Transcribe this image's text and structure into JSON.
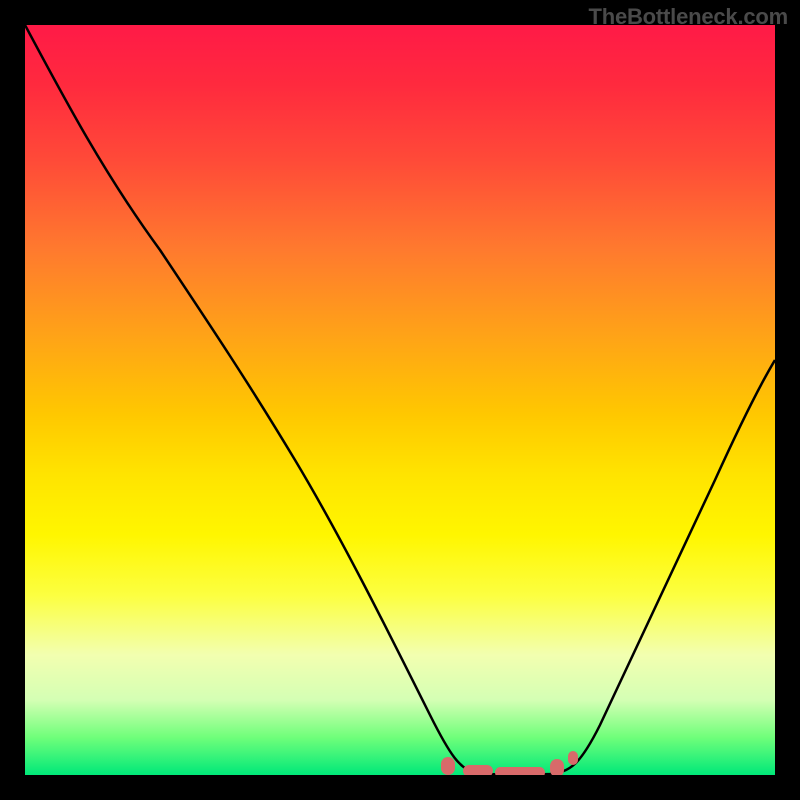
{
  "attribution": "TheBottleneck.com",
  "colors": {
    "frame": "#000000",
    "curve": "#000000",
    "marker": "#d86a6a",
    "gradient_top": "#ff1a47",
    "gradient_bottom": "#00e879"
  },
  "chart_data": {
    "type": "line",
    "title": "",
    "xlabel": "",
    "ylabel": "",
    "xlim": [
      0,
      100
    ],
    "ylim": [
      0,
      100
    ],
    "note": "Axes are unlabeled; values are visual estimates on a 0–100 scale. Curve is a V shape with a flat valley at y≈0 around x≈60–70, rising steeply toward both edges.",
    "series": [
      {
        "name": "curve",
        "x": [
          0,
          6,
          12,
          18,
          24,
          30,
          36,
          42,
          48,
          54,
          58,
          60,
          62,
          66,
          70,
          72,
          76,
          82,
          88,
          94,
          100
        ],
        "values": [
          100,
          90,
          80,
          70,
          60,
          49,
          38,
          27,
          16,
          6,
          1,
          0,
          0,
          0,
          0,
          1,
          6,
          17,
          29,
          42,
          55
        ]
      }
    ],
    "markers": {
      "note": "Pink segment near valley bottom with endpoint dots",
      "x_range": [
        55,
        72
      ],
      "y": 0
    }
  }
}
